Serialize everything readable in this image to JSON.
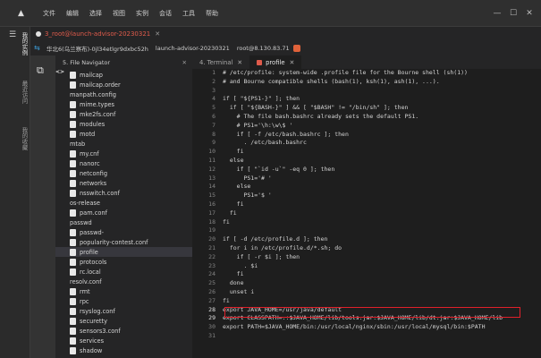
{
  "app": {
    "menu": [
      "文件",
      "编辑",
      "选择",
      "视图",
      "实例",
      "会话",
      "工具",
      "帮助"
    ]
  },
  "titlebar": {
    "tab_title": "3_root@launch-advisor-20230321"
  },
  "breadcrumb": {
    "items": [
      "华北6(乌兰察布)-0jl34etlgr9dxbc52h",
      "launch-advisor-20230321",
      "root@8.130.83.71"
    ]
  },
  "left_strip": {
    "labels": [
      "我的实例",
      "最近访问",
      "我的收藏"
    ]
  },
  "file_navigator": {
    "title": "5. File Navigator",
    "files": [
      {
        "name": "mailcap",
        "type": "file"
      },
      {
        "name": "mailcap.order",
        "type": "file"
      },
      {
        "name": "manpath.config",
        "type": "code"
      },
      {
        "name": "mime.types",
        "type": "file"
      },
      {
        "name": "mke2fs.conf",
        "type": "file"
      },
      {
        "name": "modules",
        "type": "file"
      },
      {
        "name": "motd",
        "type": "file"
      },
      {
        "name": "mtab",
        "type": "code"
      },
      {
        "name": "my.cnf",
        "type": "file"
      },
      {
        "name": "nanorc",
        "type": "file"
      },
      {
        "name": "netconfig",
        "type": "file"
      },
      {
        "name": "networks",
        "type": "file"
      },
      {
        "name": "nsswitch.conf",
        "type": "file"
      },
      {
        "name": "os-release",
        "type": "code"
      },
      {
        "name": "pam.conf",
        "type": "file"
      },
      {
        "name": "passwd",
        "type": "code"
      },
      {
        "name": "passwd-",
        "type": "file"
      },
      {
        "name": "popularity-contest.conf",
        "type": "file"
      },
      {
        "name": "profile",
        "type": "file",
        "selected": true
      },
      {
        "name": "protocols",
        "type": "file"
      },
      {
        "name": "rc.local",
        "type": "file"
      },
      {
        "name": "resolv.conf",
        "type": "code"
      },
      {
        "name": "rmt",
        "type": "file"
      },
      {
        "name": "rpc",
        "type": "file"
      },
      {
        "name": "rsyslog.conf",
        "type": "file"
      },
      {
        "name": "securetty",
        "type": "file"
      },
      {
        "name": "sensors3.conf",
        "type": "file"
      },
      {
        "name": "services",
        "type": "file"
      },
      {
        "name": "shadow",
        "type": "file"
      }
    ]
  },
  "editor": {
    "tabs": [
      {
        "label": "4. Terminal",
        "active": false
      },
      {
        "label": "profile",
        "active": true
      }
    ],
    "lines": [
      "# /etc/profile: system-wide .profile file for the Bourne shell (sh(1))",
      "# and Bourne compatible shells (bash(1), ksh(1), ash(1), ...).",
      "",
      "if [ \"${PS1-}\" ]; then",
      "  if [ \"${BASH-}\" ] && [ \"$BASH\" != \"/bin/sh\" ]; then",
      "    # The file bash.bashrc already sets the default PS1.",
      "    # PS1='\\h:\\w\\$ '",
      "    if [ -f /etc/bash.bashrc ]; then",
      "      . /etc/bash.bashrc",
      "    fi",
      "  else",
      "    if [ \"`id -u`\" -eq 0 ]; then",
      "      PS1='# '",
      "    else",
      "      PS1='$ '",
      "    fi",
      "  fi",
      "fi",
      "",
      "if [ -d /etc/profile.d ]; then",
      "  for i in /etc/profile.d/*.sh; do",
      "    if [ -r $i ]; then",
      "      . $i",
      "    fi",
      "  done",
      "  unset i",
      "fi",
      "export JAVA_HOME=/usr/java/default",
      "export CLASSPATH=.:$JAVA_HOME/lib/tools.jar:$JAVA_HOME/lib/dt.jar:$JAVA_HOME/lib",
      "export PATH=$JAVA_HOME/bin:/usr/local/nginx/sbin:/usr/local/mysql/bin:$PATH",
      ""
    ],
    "bold_lines": [
      28,
      29
    ],
    "highlighted_line": 29
  }
}
